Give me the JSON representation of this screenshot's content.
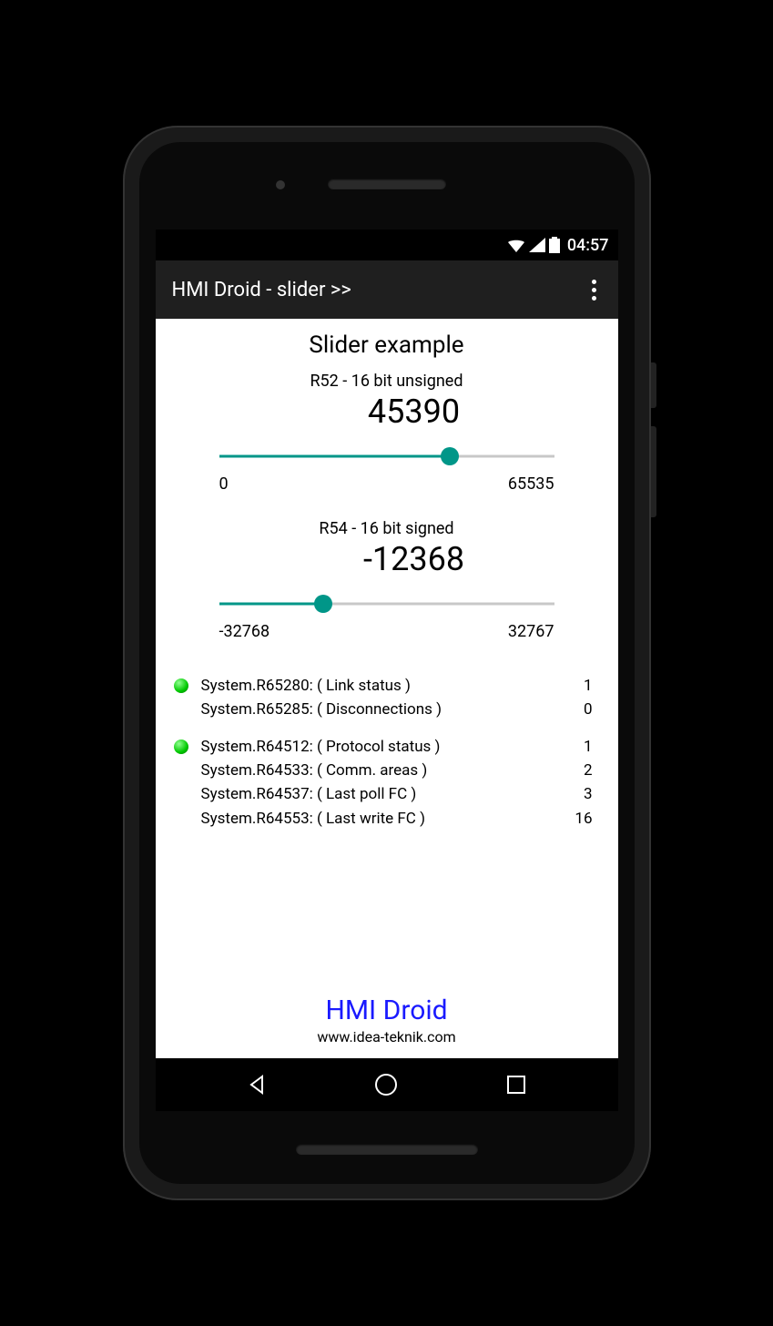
{
  "status_bar": {
    "time": "04:57"
  },
  "app_bar": {
    "title": "HMI Droid - slider >>"
  },
  "page": {
    "title": "Slider example",
    "sliders": [
      {
        "label": "R52 - 16 bit unsigned",
        "value": "45390",
        "min": "0",
        "max": "65535",
        "fill_pct": 69
      },
      {
        "label": "R54 - 16 bit signed",
        "value": "-12368",
        "min": "-32768",
        "max": "32767",
        "fill_pct": 31
      }
    ],
    "status_groups": [
      [
        {
          "led": true,
          "label": "System.R65280: ( Link status )",
          "value": "1"
        },
        {
          "led": false,
          "label": "System.R65285: ( Disconnections )",
          "value": "0"
        }
      ],
      [
        {
          "led": true,
          "label": "System.R64512: ( Protocol status )",
          "value": "1"
        },
        {
          "led": false,
          "label": "System.R64533: ( Comm. areas )",
          "value": "2"
        },
        {
          "led": false,
          "label": "System.R64537: ( Last poll FC )",
          "value": "3"
        },
        {
          "led": false,
          "label": "System.R64553: ( Last write FC )",
          "value": "16"
        }
      ]
    ],
    "footer": {
      "title": "HMI Droid",
      "url": "www.idea-teknik.com"
    }
  }
}
